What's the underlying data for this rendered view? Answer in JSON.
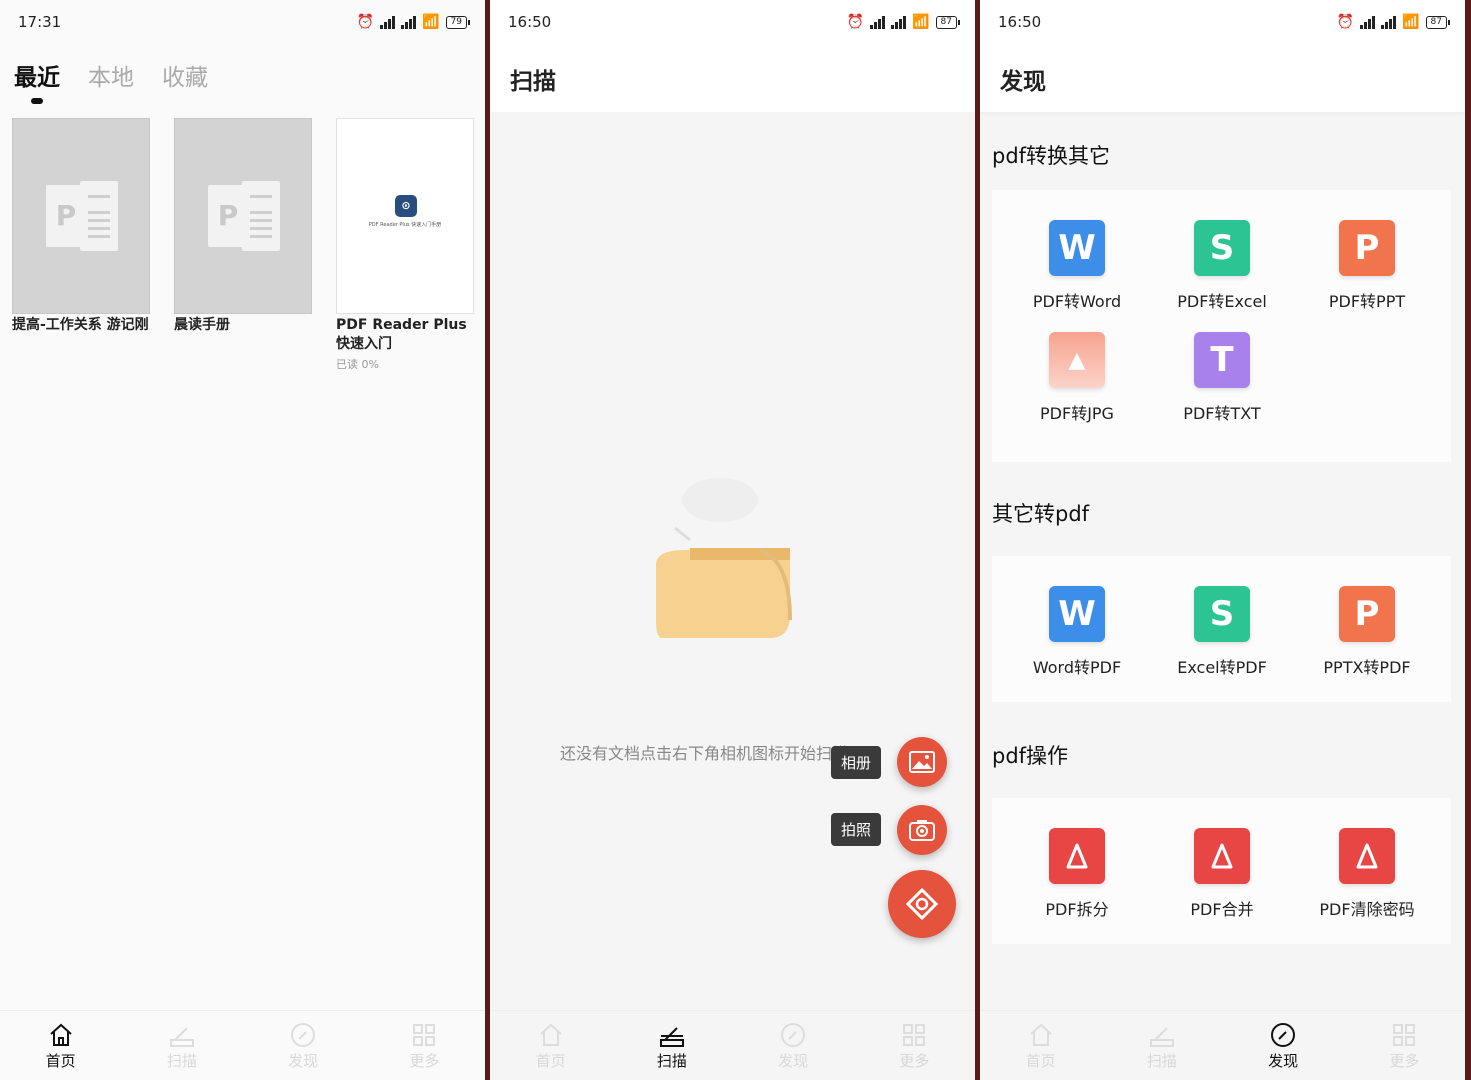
{
  "panel1": {
    "time": "17:31",
    "battery": "79",
    "tabs": [
      "最近",
      "本地",
      "收藏"
    ],
    "docs": [
      {
        "title": "提高-工作关系 游记刚",
        "meta": ""
      },
      {
        "title": "晨读手册",
        "meta": ""
      },
      {
        "title": "PDF Reader Plus快速入门",
        "meta": "已读  0%"
      }
    ],
    "thumb_text": "PDF Reader Plus 快速入门手册",
    "nav": [
      "首页",
      "扫描",
      "发现",
      "更多"
    ]
  },
  "panel2": {
    "time": "16:50",
    "battery": "87",
    "title": "扫描",
    "empty_text": "还没有文档点击右下角相机图标开始扫描吧！",
    "album_label": "相册",
    "photo_label": "拍照",
    "nav": [
      "首页",
      "扫描",
      "发现",
      "更多"
    ]
  },
  "panel3": {
    "time": "16:50",
    "battery": "87",
    "title": "发现",
    "sections": [
      {
        "title": "pdf转换其它",
        "tools": [
          {
            "label": "PDF转Word",
            "color": "#3d8ee8",
            "glyph": "W"
          },
          {
            "label": "PDF转Excel",
            "color": "#2bc492",
            "glyph": "S"
          },
          {
            "label": "PDF转PPT",
            "color": "#f2744d",
            "glyph": "P"
          },
          {
            "label": "PDF转JPG",
            "color": "#f47f6a",
            "glyph": "▲"
          },
          {
            "label": "PDF转TXT",
            "color": "#a881ec",
            "glyph": "T"
          }
        ]
      },
      {
        "title": "其它转pdf",
        "tools": [
          {
            "label": "Word转PDF",
            "color": "#3d8ee8",
            "glyph": "W"
          },
          {
            "label": "Excel转PDF",
            "color": "#2bc492",
            "glyph": "S"
          },
          {
            "label": "PPTX转PDF",
            "color": "#f2744d",
            "glyph": "P"
          }
        ]
      },
      {
        "title": "pdf操作",
        "tools": [
          {
            "label": "PDF拆分",
            "color": "#e84545",
            "glyph": "A"
          },
          {
            "label": "PDF合并",
            "color": "#e84545",
            "glyph": "A"
          },
          {
            "label": "PDF清除密码",
            "color": "#e84545",
            "glyph": "A"
          }
        ]
      }
    ],
    "nav": [
      "首页",
      "扫描",
      "发现",
      "更多"
    ]
  }
}
